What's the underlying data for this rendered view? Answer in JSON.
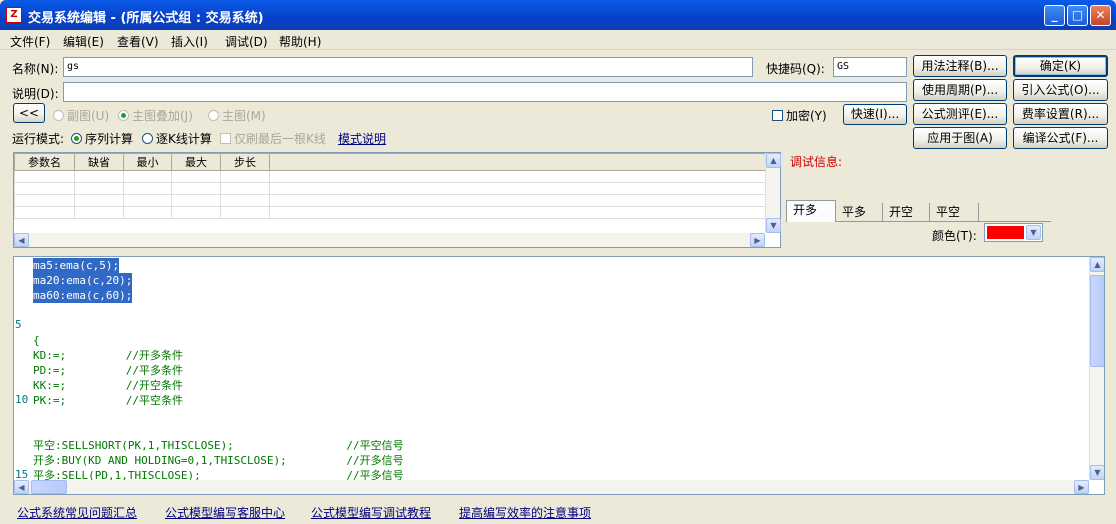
{
  "window": {
    "title": "交易系统编辑 - (所属公式组 : 交易系统)",
    "icon_text": "Z"
  },
  "menu": [
    "文件(F)",
    "编辑(E)",
    "查看(V)",
    "插入(I)",
    "调试(D)",
    "帮助(H)"
  ],
  "form": {
    "name_label": "名称(N):",
    "name_value": "gs",
    "hotkey_label": "快捷码(Q):",
    "hotkey_value": "GS",
    "desc_label": "说明(D):",
    "desc_value": "",
    "collapse_label": "<<",
    "chart_options": [
      "副图(U)",
      "主图叠加(J)",
      "主图(M)"
    ],
    "encrypt_label": "加密(Y)",
    "quick_label": "快速(I)...",
    "run_mode_label": "运行模式:",
    "run_modes": [
      "序列计算",
      "逐K线计算"
    ],
    "last_bar_label": "仅刷最后一根K线",
    "mode_help_link": "模式说明"
  },
  "buttons": {
    "usage_notes": "用法注释(B)...",
    "ok": "确定(K)",
    "use_period": "使用周期(P)...",
    "import_formula": "引入公式(O)...",
    "formula_eval": "公式测评(E)...",
    "fee_settings": "费率设置(R)...",
    "apply_chart": "应用于图(A)",
    "compile_formula": "编译公式(F)..."
  },
  "param_table": {
    "headers": [
      "参数名",
      "缺省",
      "最小",
      "最大",
      "步长"
    ],
    "rows": 4
  },
  "debug": {
    "label": "调试信息:",
    "label_color": "#cc0000",
    "tabs": [
      "开多",
      "平多",
      "开空",
      "平空"
    ],
    "active_tab": 0,
    "color_label": "颜色(T):",
    "color_value": "#ff0000"
  },
  "editor": {
    "lines": [
      {
        "num": "",
        "text": "ma5:ema(c,5);",
        "selected": true
      },
      {
        "num": "",
        "text": "ma20:ema(c,20);",
        "selected": true
      },
      {
        "num": "",
        "text": "ma60:ema(c,60);",
        "selected": true
      },
      {
        "num": "",
        "text": "",
        "selected": false
      },
      {
        "num": "5",
        "text": "",
        "selected": false
      },
      {
        "num": "",
        "text": "{",
        "selected": false
      },
      {
        "num": "",
        "text": "KD:=;         //开多条件",
        "selected": false
      },
      {
        "num": "",
        "text": "PD:=;         //平多条件",
        "selected": false
      },
      {
        "num": "",
        "text": "KK:=;         //开空条件",
        "selected": false
      },
      {
        "num": "10",
        "text": "PK:=;         //平空条件",
        "selected": false
      },
      {
        "num": "",
        "text": "",
        "selected": false
      },
      {
        "num": "",
        "text": "",
        "selected": false
      },
      {
        "num": "",
        "text": "平空:SELLSHORT(PK,1,THISCLOSE);                 //平空信号",
        "selected": false
      },
      {
        "num": "",
        "text": "开多:BUY(KD AND HOLDING=0,1,THISCLOSE);         //开多信号",
        "selected": false
      },
      {
        "num": "15",
        "text": "平多:SELL(PD,1,THISCLOSE);                      //平多信号",
        "selected": false
      }
    ]
  },
  "footer_links": [
    "公式系统常见问题汇总",
    "公式模型编写客服中心",
    "公式模型编写调试教程",
    "提高编写效率的注意事项"
  ]
}
